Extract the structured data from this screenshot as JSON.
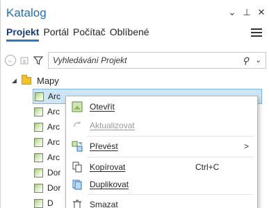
{
  "pane": {
    "title": "Katalog",
    "window_buttons": [
      "⌄",
      "⊥",
      "✕"
    ]
  },
  "tabs": [
    "Projekt",
    "Portál",
    "Počítač",
    "Oblíbené"
  ],
  "search": {
    "placeholder": "Vyhledávání Projekt"
  },
  "tree": {
    "root_label": "Mapy",
    "items": [
      "Arc",
      "Arc",
      "Arc",
      "Arc",
      "Arc",
      "Dor",
      "Dor",
      "D"
    ]
  },
  "context_menu": {
    "items": [
      {
        "label": "Otevřít",
        "shortcut": "",
        "disabled": false,
        "submenu": false
      },
      {
        "label": "Aktualizovat",
        "shortcut": "",
        "disabled": true,
        "submenu": false
      },
      {
        "label": "Převést",
        "shortcut": "",
        "disabled": false,
        "submenu": true,
        "arrow": ">"
      },
      {
        "label": "Kopírovat",
        "shortcut": "Ctrl+C",
        "disabled": false,
        "submenu": false
      },
      {
        "label": "Duplikovat",
        "shortcut": "",
        "disabled": false,
        "submenu": false
      },
      {
        "label": "Smazat",
        "shortcut": "",
        "disabled": false,
        "submenu": false
      }
    ]
  },
  "colors": {
    "title": "#1f6fb4",
    "tab_underline": "#2b78c5",
    "selection": "#cde6f7"
  }
}
